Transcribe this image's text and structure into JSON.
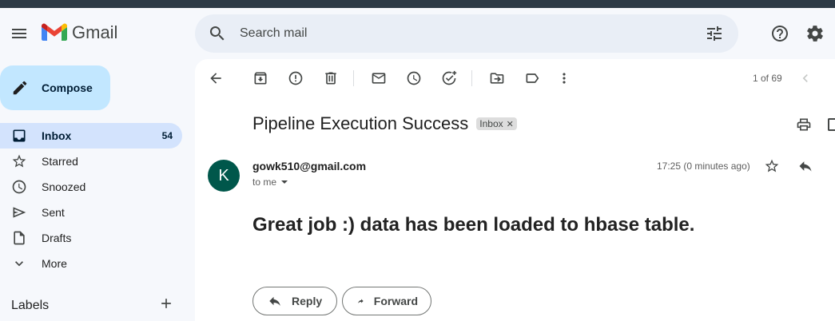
{
  "app": {
    "name": "Gmail"
  },
  "search": {
    "placeholder": "Search mail"
  },
  "sidebar": {
    "compose_label": "Compose",
    "items": [
      {
        "label": "Inbox",
        "count": "54",
        "icon": "inbox-icon"
      },
      {
        "label": "Starred",
        "count": "",
        "icon": "star-icon"
      },
      {
        "label": "Snoozed",
        "count": "",
        "icon": "clock-icon"
      },
      {
        "label": "Sent",
        "count": "",
        "icon": "send-icon"
      },
      {
        "label": "Drafts",
        "count": "",
        "icon": "draft-icon"
      },
      {
        "label": "More",
        "count": "",
        "icon": "chevron-down-icon"
      }
    ],
    "labels_heading": "Labels"
  },
  "toolbar": {
    "pager": "1 of 69"
  },
  "email": {
    "subject": "Pipeline Execution Success",
    "label_chip": "Inbox",
    "sender": "gowk510@gmail.com",
    "recipient": "to me",
    "time": "17:25 (0 minutes ago)",
    "avatar_letter": "K",
    "body": "Great job :) data has been loaded to hbase table."
  },
  "actions": {
    "reply": "Reply",
    "forward": "Forward"
  },
  "colors": {
    "compose_bg": "#c2e7ff",
    "active_nav": "#d3e3fd",
    "avatar_bg": "#00574b",
    "page_bg": "#f6f8fc"
  }
}
